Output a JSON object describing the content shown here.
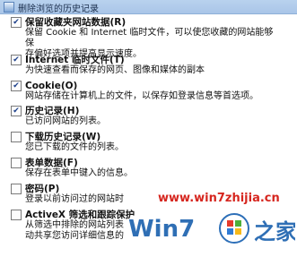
{
  "window": {
    "title": "删除浏览的历史记录"
  },
  "options": [
    {
      "label": "保留收藏夹网站数据(R)",
      "desc": [
        "保留 Cookie 和 Internet 临时文件，可以使您收藏的网站能够保",
        "存偏好选项并提高显示速度。"
      ],
      "checked": true
    },
    {
      "label": "Internet 临时文件(T)",
      "desc": [
        "为快速查看而保存的网页、图像和媒体的副本"
      ],
      "checked": true
    },
    {
      "label": "Cookie(O)",
      "desc": [
        "网站存储在计算机上的文件，以保存如登录信息等首选项。"
      ],
      "checked": true
    },
    {
      "label": "历史记录(H)",
      "desc": [
        "已访问网站的列表。"
      ],
      "checked": true
    },
    {
      "label": "下载历史记录(W)",
      "desc": [
        "您已下载的文件的列表。"
      ],
      "checked": false
    },
    {
      "label": "表单数据(F)",
      "desc": [
        "保存在表单中键入的信息。"
      ],
      "checked": false
    },
    {
      "label": "密码(P)",
      "desc": [
        "登录以前访问过的网站时"
      ],
      "checked": false
    },
    {
      "label": "ActiveX 筛选和跟踪保护",
      "desc": [
        "从筛选中排除的网站列表",
        "动共享您访问详细信息的"
      ],
      "checked": false
    }
  ],
  "watermark": {
    "url": "www.win7zhijia.cn",
    "logo_text": "Win7",
    "logo_char": "之家"
  }
}
